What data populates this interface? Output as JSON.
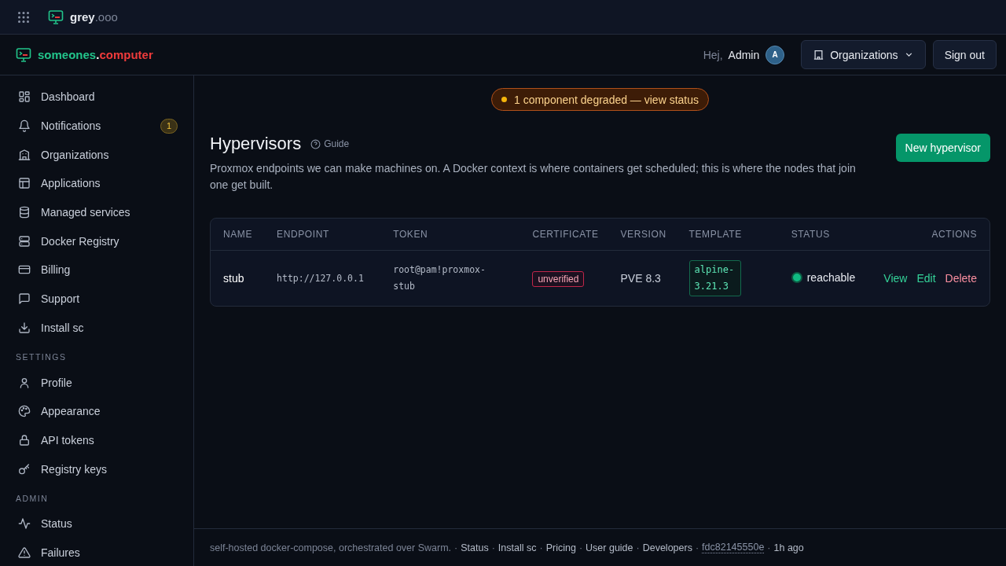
{
  "topbar": {
    "brand_main": "grey",
    "brand_suffix": ".ooo"
  },
  "header": {
    "brand_main": "someones",
    "brand_dot": ".",
    "brand_suffix": "computer",
    "greeting": "Hej,",
    "user": "Admin",
    "avatar": "A",
    "org_button": "Organizations",
    "sign_out": "Sign out"
  },
  "sidebar": {
    "sections": [
      {
        "items": [
          {
            "label": "Dashboard",
            "selected": false
          },
          {
            "label": "Notifications",
            "selected": false,
            "badge": "1"
          },
          {
            "label": "Organizations",
            "selected": false
          },
          {
            "label": "Applications",
            "selected": false
          },
          {
            "label": "Managed services",
            "selected": false
          },
          {
            "label": "Docker Registry",
            "selected": false
          },
          {
            "label": "Billing",
            "selected": false
          },
          {
            "label": "Support",
            "selected": false
          },
          {
            "label": "Install sc",
            "selected": false
          }
        ]
      },
      {
        "heading": "SETTINGS",
        "items": [
          {
            "label": "Profile",
            "selected": false
          },
          {
            "label": "Appearance",
            "selected": false
          },
          {
            "label": "API tokens",
            "selected": false
          },
          {
            "label": "Registry keys",
            "selected": false
          }
        ]
      },
      {
        "heading": "ADMIN",
        "items": [
          {
            "label": "Status",
            "selected": false
          },
          {
            "label": "Failures",
            "selected": false
          }
        ]
      }
    ]
  },
  "banner": {
    "text": "1 component degraded — view status"
  },
  "page": {
    "title": "Hypervisors",
    "guide": "Guide",
    "description": "Proxmox endpoints we can make machines on. A Docker context is where containers get scheduled; this is where the nodes that join one get built.",
    "new_button": "New hypervisor"
  },
  "table": {
    "columns": [
      "NAME",
      "ENDPOINT",
      "TOKEN",
      "CERTIFICATE",
      "VERSION",
      "TEMPLATE",
      "STATUS",
      "ACTIONS"
    ],
    "rows": [
      {
        "name": "stub",
        "endpoint": "http://127.0.0.1",
        "token": "root@pam!proxmox-stub",
        "certificate": "unverified",
        "version": "PVE 8.3",
        "template": "alpine-3.21.3",
        "status": "reachable",
        "actions": [
          {
            "label": "View",
            "kind": "normal"
          },
          {
            "label": "Edit",
            "kind": "normal"
          },
          {
            "label": "Delete",
            "kind": "danger"
          }
        ]
      }
    ]
  },
  "footer": {
    "separator": "·",
    "items": [
      {
        "text": "self-hosted docker-compose, orchestrated over Swarm.",
        "kind": "text"
      },
      {
        "text": "Status",
        "kind": "link"
      },
      {
        "text": "Install sc",
        "kind": "link"
      },
      {
        "text": "Pricing",
        "kind": "link"
      },
      {
        "text": "User guide",
        "kind": "link"
      },
      {
        "text": "Developers",
        "kind": "link"
      },
      {
        "text": "fdc82145550e",
        "kind": "commit"
      },
      {
        "text": "1h ago",
        "kind": "time"
      }
    ]
  }
}
